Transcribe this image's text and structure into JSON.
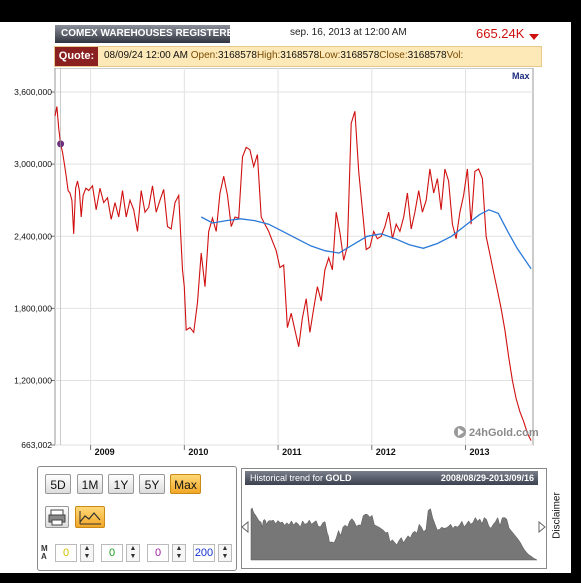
{
  "header": {
    "title": "COMEX WAREHOUSES REGISTERED GC",
    "date": "sep. 16, 2013 at 12:00 AM",
    "price": "665.24K",
    "price_color": "#d01010"
  },
  "quote": {
    "label": "Quote:",
    "date": "08/09/24 12:00 AM",
    "open_label": "Open:",
    "open": "3168578",
    "high_label": "High:",
    "high": "3168578",
    "low_label": "Low:",
    "low": "3168578",
    "close_label": "Close:",
    "close": "3168578",
    "vol_label": "Vol:"
  },
  "chart_data": {
    "type": "line",
    "max_label": "Max",
    "watermark": "24hGold.com",
    "ylim": [
      663002,
      3800000
    ],
    "y_ticks": [
      663002,
      1200000,
      1800000,
      2400000,
      3000000,
      3600000
    ],
    "y_tick_labels": [
      "663,002",
      "1,200,000",
      "1,800,000",
      "2,400,000",
      "3,000,000",
      "3,600,000"
    ],
    "x_tick_labels": [
      "2009",
      "2010",
      "2011",
      "2012",
      "2013"
    ],
    "x_tick_dates": [
      2009.0,
      2010.0,
      2011.0,
      2012.0,
      2013.0
    ],
    "xlim": [
      2008.62,
      2013.72
    ],
    "grid": true,
    "series": [
      {
        "color": "#d01010",
        "x": [
          2008.62,
          2008.64,
          2008.66,
          2008.68,
          2008.7,
          2008.72,
          2008.74,
          2008.76,
          2008.78,
          2008.8,
          2008.82,
          2008.84,
          2008.86,
          2008.88,
          2008.9,
          2008.92,
          2008.95,
          2008.98,
          2009.02,
          2009.06,
          2009.1,
          2009.14,
          2009.18,
          2009.22,
          2009.26,
          2009.3,
          2009.34,
          2009.38,
          2009.42,
          2009.46,
          2009.5,
          2009.54,
          2009.58,
          2009.62,
          2009.66,
          2009.7,
          2009.74,
          2009.78,
          2009.82,
          2009.86,
          2009.9,
          2009.94,
          2009.98,
          2010.0,
          2010.02,
          2010.06,
          2010.1,
          2010.14,
          2010.18,
          2010.22,
          2010.26,
          2010.3,
          2010.34,
          2010.38,
          2010.42,
          2010.46,
          2010.5,
          2010.54,
          2010.58,
          2010.62,
          2010.66,
          2010.7,
          2010.74,
          2010.78,
          2010.82,
          2010.86,
          2010.9,
          2010.94,
          2010.98,
          2011.02,
          2011.06,
          2011.1,
          2011.14,
          2011.18,
          2011.22,
          2011.26,
          2011.3,
          2011.34,
          2011.38,
          2011.42,
          2011.46,
          2011.5,
          2011.54,
          2011.58,
          2011.62,
          2011.66,
          2011.7,
          2011.74,
          2011.78,
          2011.82,
          2011.86,
          2011.9,
          2011.94,
          2011.98,
          2012.02,
          2012.06,
          2012.1,
          2012.14,
          2012.18,
          2012.22,
          2012.26,
          2012.3,
          2012.34,
          2012.38,
          2012.42,
          2012.46,
          2012.5,
          2012.54,
          2012.58,
          2012.62,
          2012.66,
          2012.7,
          2012.74,
          2012.78,
          2012.82,
          2012.86,
          2012.9,
          2012.94,
          2012.98,
          2013.02,
          2013.06,
          2013.1,
          2013.14,
          2013.18,
          2013.22,
          2013.26,
          2013.3,
          2013.34,
          2013.38,
          2013.42,
          2013.46,
          2013.5,
          2013.54,
          2013.58,
          2013.62,
          2013.66,
          2013.7
        ],
        "values": [
          3400000,
          3480000,
          3300000,
          3168578,
          3100000,
          3000000,
          2900000,
          2780000,
          2760000,
          2700000,
          2420000,
          2800000,
          2860000,
          2780000,
          2560000,
          2740000,
          2800000,
          2780000,
          2820000,
          2620000,
          2800000,
          2680000,
          2720000,
          2540000,
          2680000,
          2560000,
          2780000,
          2560000,
          2700000,
          2620000,
          2440000,
          2780000,
          2600000,
          2640000,
          2820000,
          2600000,
          2700000,
          2790000,
          2480000,
          2460000,
          2680000,
          2740000,
          2120000,
          1980000,
          1620000,
          1640000,
          1600000,
          1850000,
          2260000,
          1980000,
          2440000,
          2550000,
          2440000,
          2760000,
          2900000,
          2740000,
          2480000,
          2560000,
          2550000,
          3060000,
          3140000,
          3120000,
          2980000,
          3080000,
          2560000,
          2500000,
          2440000,
          2360000,
          2280000,
          2140000,
          2160000,
          1640000,
          1760000,
          1620000,
          1480000,
          1720000,
          1880000,
          1600000,
          1800000,
          1980000,
          1860000,
          2120000,
          2220000,
          2120000,
          2600000,
          2430000,
          2200000,
          2320000,
          3340000,
          3440000,
          2940000,
          2620000,
          2290000,
          2310000,
          2440000,
          2380000,
          2400000,
          2480000,
          2600000,
          2380000,
          2500000,
          2440000,
          2560000,
          2760000,
          2460000,
          2600000,
          2780000,
          2600000,
          2700000,
          2960000,
          2760000,
          2880000,
          2620000,
          2960000,
          2860000,
          2500000,
          2380000,
          2600000,
          2740000,
          2960000,
          2500000,
          2940000,
          2960000,
          2880000,
          2400000,
          2250000,
          2100000,
          1950000,
          1800000,
          1620000,
          1400000,
          1200000,
          1050000,
          940000,
          860000,
          760000,
          700000
        ]
      },
      {
        "color": "#2a7ad8",
        "x": [
          2010.18,
          2010.3,
          2010.45,
          2010.6,
          2010.75,
          2010.9,
          2011.05,
          2011.2,
          2011.35,
          2011.5,
          2011.65,
          2011.8,
          2011.95,
          2012.1,
          2012.25,
          2012.4,
          2012.55,
          2012.7,
          2012.85,
          2013.0,
          2013.15,
          2013.25,
          2013.35,
          2013.45,
          2013.55,
          2013.7
        ],
        "values": [
          2560000,
          2510000,
          2530000,
          2545000,
          2530000,
          2500000,
          2440000,
          2380000,
          2320000,
          2280000,
          2260000,
          2330000,
          2400000,
          2420000,
          2380000,
          2330000,
          2300000,
          2340000,
          2400000,
          2490000,
          2580000,
          2620000,
          2590000,
          2440000,
          2300000,
          2130000
        ]
      }
    ]
  },
  "controls": {
    "periods": [
      "5D",
      "1M",
      "1Y",
      "5Y",
      "Max"
    ],
    "active_period": "Max",
    "ma_label": "MA",
    "ma_values": [
      "0",
      "0",
      "0",
      "200"
    ],
    "ma_colors": [
      "#d4c000",
      "#1aa01a",
      "#a020a0",
      "#1030d0"
    ]
  },
  "navigator": {
    "title": "Historical trend for",
    "symbol": "GOLD",
    "range": "2008/08/29-2013/09/16",
    "disclaimer": "Disclaimer"
  }
}
